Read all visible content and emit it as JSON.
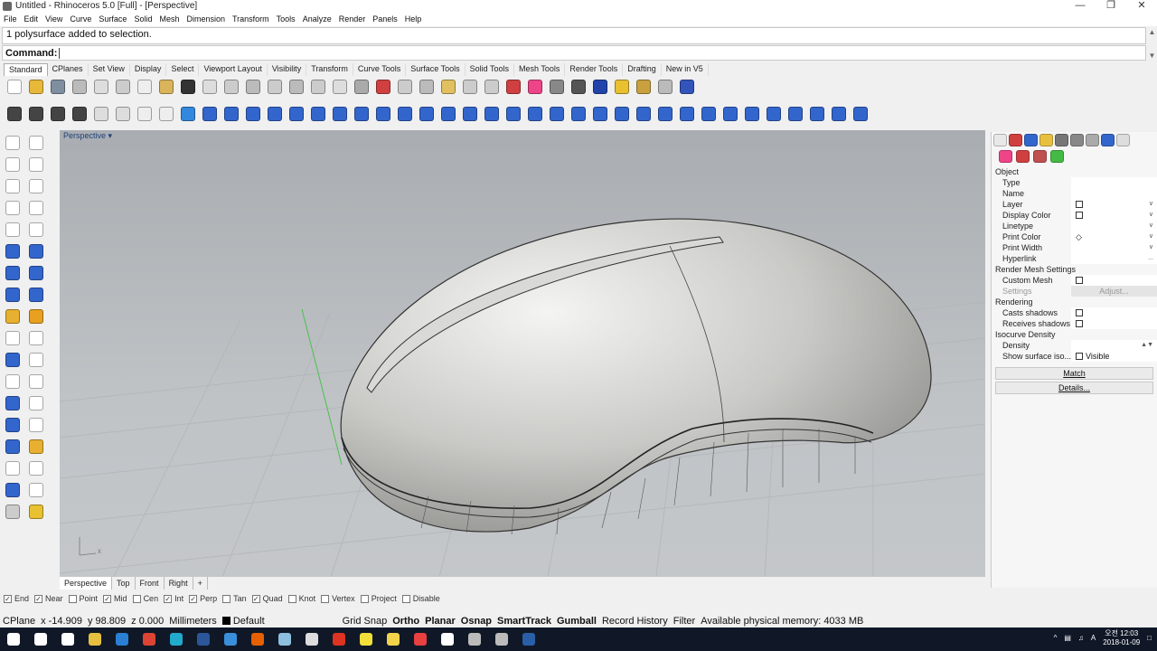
{
  "window": {
    "title": "Untitled - Rhinoceros 5.0 [Full] - [Perspective]",
    "controls": [
      "—",
      "❐",
      "✕"
    ]
  },
  "menu": [
    "File",
    "Edit",
    "View",
    "Curve",
    "Surface",
    "Solid",
    "Mesh",
    "Dimension",
    "Transform",
    "Tools",
    "Analyze",
    "Render",
    "Panels",
    "Help"
  ],
  "command_history": "1 polysurface added to selection.",
  "command": {
    "label": "Command:",
    "value": ""
  },
  "toolbar_tabs": [
    "Standard",
    "CPlanes",
    "Set View",
    "Display",
    "Select",
    "Viewport Layout",
    "Visibility",
    "Transform",
    "Curve Tools",
    "Surface Tools",
    "Solid Tools",
    "Mesh Tools",
    "Render Tools",
    "Drafting",
    "New in V5"
  ],
  "toolbar_icons_row1": [
    {
      "name": "new-icon",
      "color": "#ffffff"
    },
    {
      "name": "open-icon",
      "color": "#e8b83a"
    },
    {
      "name": "save-icon",
      "color": "#7f8f9f"
    },
    {
      "name": "print-icon",
      "color": "#bbbbbb"
    },
    {
      "name": "export-icon",
      "color": "#dddddd"
    },
    {
      "name": "cut-icon",
      "color": "#cccccc"
    },
    {
      "name": "copy-icon",
      "color": "#eeeeee"
    },
    {
      "name": "paste-icon",
      "color": "#d9b45b"
    },
    {
      "name": "undo-icon",
      "color": "#333333"
    },
    {
      "name": "pan-icon",
      "color": "#dddddd"
    },
    {
      "name": "rotate-view-icon",
      "color": "#cccccc"
    },
    {
      "name": "zoom-icon",
      "color": "#bbbbbb"
    },
    {
      "name": "zoom-window-icon",
      "color": "#cccccc"
    },
    {
      "name": "zoom-extents-icon",
      "color": "#bbbbbb"
    },
    {
      "name": "zoom-selected-icon",
      "color": "#cccccc"
    },
    {
      "name": "undo-view-icon",
      "color": "#dddddd"
    },
    {
      "name": "four-views-icon",
      "color": "#aaaaaa"
    },
    {
      "name": "grid-snap-icon",
      "color": "#d04040"
    },
    {
      "name": "cplane-icon",
      "color": "#cccccc"
    },
    {
      "name": "select-icon",
      "color": "#bbbbbb"
    },
    {
      "name": "points-icon",
      "color": "#e0c060"
    },
    {
      "name": "light-icon",
      "color": "#cccccc"
    },
    {
      "name": "lock-icon",
      "color": "#cccccc"
    },
    {
      "name": "layer-icon",
      "color": "#d04040"
    },
    {
      "name": "color-wheel-icon",
      "color": "#ee4488"
    },
    {
      "name": "shaded-icon",
      "color": "#888888"
    },
    {
      "name": "rendered-icon",
      "color": "#555555"
    },
    {
      "name": "render-icon",
      "color": "#2244aa"
    },
    {
      "name": "filter-icon",
      "color": "#e8c030"
    },
    {
      "name": "options-icon",
      "color": "#c8a040"
    },
    {
      "name": "snap-icon",
      "color": "#bbbbbb"
    },
    {
      "name": "help-icon",
      "color": "#3355bb"
    }
  ],
  "toolbar_icons_row2": [
    {
      "name": "mesh-tools-icon",
      "color": "#444444"
    },
    {
      "name": "mesh-tools-2-icon",
      "color": "#444444"
    },
    {
      "name": "mesh-tools-3-icon",
      "color": "#444444"
    },
    {
      "name": "mesh-tools-4-icon",
      "color": "#444444"
    },
    {
      "name": "edge-icon",
      "color": "#dddddd"
    },
    {
      "name": "disk-icon",
      "color": "#dddddd"
    },
    {
      "name": "curve-icon",
      "color": "#eeeeee"
    },
    {
      "name": "arc-icon",
      "color": "#eeeeee"
    },
    {
      "name": "sphere-icon",
      "color": "#3388dd"
    },
    {
      "name": "surface-1-icon",
      "color": "#3366cc"
    },
    {
      "name": "surface-2-icon",
      "color": "#3366cc"
    },
    {
      "name": "surface-3-icon",
      "color": "#3366cc"
    },
    {
      "name": "surface-4-icon",
      "color": "#3366cc"
    },
    {
      "name": "surface-5-icon",
      "color": "#3366cc"
    },
    {
      "name": "surface-6-icon",
      "color": "#3366cc"
    },
    {
      "name": "surface-7-icon",
      "color": "#3366cc"
    },
    {
      "name": "surface-8-icon",
      "color": "#3366cc"
    },
    {
      "name": "surface-9-icon",
      "color": "#3366cc"
    },
    {
      "name": "surface-10-icon",
      "color": "#3366cc"
    },
    {
      "name": "surface-11-icon",
      "color": "#3366cc"
    },
    {
      "name": "surface-12-icon",
      "color": "#3366cc"
    },
    {
      "name": "surface-13-icon",
      "color": "#3366cc"
    },
    {
      "name": "surface-14-icon",
      "color": "#3366cc"
    },
    {
      "name": "surface-15-icon",
      "color": "#3366cc"
    },
    {
      "name": "surface-16-icon",
      "color": "#3366cc"
    },
    {
      "name": "surface-17-icon",
      "color": "#3366cc"
    },
    {
      "name": "surface-18-icon",
      "color": "#3366cc"
    },
    {
      "name": "surface-19-icon",
      "color": "#3366cc"
    },
    {
      "name": "surface-20-icon",
      "color": "#3366cc"
    },
    {
      "name": "surface-21-icon",
      "color": "#3366cc"
    },
    {
      "name": "surface-22-icon",
      "color": "#3366cc"
    },
    {
      "name": "surface-23-icon",
      "color": "#3366cc"
    },
    {
      "name": "surface-24-icon",
      "color": "#3366cc"
    },
    {
      "name": "surface-25-icon",
      "color": "#3366cc"
    },
    {
      "name": "surface-26-icon",
      "color": "#3366cc"
    },
    {
      "name": "surface-27-icon",
      "color": "#3366cc"
    },
    {
      "name": "surface-28-icon",
      "color": "#3366cc"
    },
    {
      "name": "surface-29-icon",
      "color": "#3366cc"
    },
    {
      "name": "surface-30-icon",
      "color": "#3366cc"
    },
    {
      "name": "surface-31-icon",
      "color": "#3366cc"
    }
  ],
  "left_tools": [
    {
      "name": "select-arrow-icon",
      "color": "#ffffff"
    },
    {
      "name": "point-icon",
      "color": "#ffffff"
    },
    {
      "name": "polyline-icon",
      "color": "#ffffff"
    },
    {
      "name": "curve-interp-icon",
      "color": "#ffffff"
    },
    {
      "name": "circle-icon",
      "color": "#ffffff"
    },
    {
      "name": "ellipse-icon",
      "color": "#ffffff"
    },
    {
      "name": "arc-tool-icon",
      "color": "#ffffff"
    },
    {
      "name": "rectangle-icon",
      "color": "#ffffff"
    },
    {
      "name": "polygon-icon",
      "color": "#ffffff"
    },
    {
      "name": "curve-tools-icon",
      "color": "#ffffff"
    },
    {
      "name": "plane-icon",
      "color": "#3366cc"
    },
    {
      "name": "sweep-icon",
      "color": "#3366cc"
    },
    {
      "name": "box-icon",
      "color": "#3366cc"
    },
    {
      "name": "solid-tools-icon",
      "color": "#3366cc"
    },
    {
      "name": "cylinder-icon",
      "color": "#3366cc"
    },
    {
      "name": "mesh-icon",
      "color": "#3366cc"
    },
    {
      "name": "light-bulb-icon",
      "color": "#e8b030"
    },
    {
      "name": "render-tools-icon",
      "color": "#e8a020"
    },
    {
      "name": "transform-icon",
      "color": "#ffffff"
    },
    {
      "name": "analyze-icon",
      "color": "#ffffff"
    },
    {
      "name": "boolean-icon",
      "color": "#3366cc"
    },
    {
      "name": "group-icon",
      "color": "#ffffff"
    },
    {
      "name": "fillet-icon",
      "color": "#ffffff"
    },
    {
      "name": "split-icon",
      "color": "#ffffff"
    },
    {
      "name": "text-icon",
      "color": "#3366cc"
    },
    {
      "name": "dimension-icon",
      "color": "#ffffff"
    },
    {
      "name": "array-icon",
      "color": "#3366cc"
    },
    {
      "name": "block-icon",
      "color": "#ffffff"
    },
    {
      "name": "extrude-icon",
      "color": "#3366cc"
    },
    {
      "name": "ruler-icon",
      "color": "#e8b030"
    },
    {
      "name": "grid-icon",
      "color": "#ffffff"
    },
    {
      "name": "move-icon",
      "color": "#ffffff"
    },
    {
      "name": "properties-icon",
      "color": "#3366cc"
    },
    {
      "name": "check-icon",
      "color": "#ffffff"
    },
    {
      "name": "materials-icon",
      "color": "#cccccc"
    },
    {
      "name": "warning-icon",
      "color": "#e8c030"
    }
  ],
  "viewport": {
    "label": "Perspective",
    "label_arrow": "▾",
    "tabs": [
      "Perspective",
      "Top",
      "Front",
      "Right",
      "+"
    ]
  },
  "osnap": [
    {
      "label": "End",
      "checked": true
    },
    {
      "label": "Near",
      "checked": true
    },
    {
      "label": "Point",
      "checked": false
    },
    {
      "label": "Mid",
      "checked": true
    },
    {
      "label": "Cen",
      "checked": false
    },
    {
      "label": "Int",
      "checked": true
    },
    {
      "label": "Perp",
      "checked": true
    },
    {
      "label": "Tan",
      "checked": false
    },
    {
      "label": "Quad",
      "checked": true
    },
    {
      "label": "Knot",
      "checked": false
    },
    {
      "label": "Vertex",
      "checked": false
    },
    {
      "label": "Project",
      "checked": false
    },
    {
      "label": "Disable",
      "checked": false
    }
  ],
  "status": {
    "cplane": "CPlane",
    "x": "x -14.909",
    "y": "y 98.809",
    "z": "z 0.000",
    "units": "Millimeters",
    "layer": "Default",
    "grid_snap": "Grid Snap",
    "ortho": "Ortho",
    "planar": "Planar",
    "osnap": "Osnap",
    "smarttrack": "SmartTrack",
    "gumball": "Gumball",
    "record_history": "Record History",
    "filter": "Filter",
    "memory": "Available physical memory: 4033 MB"
  },
  "panel": {
    "object_header": "Object",
    "rows": [
      {
        "label": "Type",
        "value": ""
      },
      {
        "label": "Name",
        "value": ""
      },
      {
        "label": "Layer",
        "value": "",
        "checkbox": true,
        "dropdown": true
      },
      {
        "label": "Display Color",
        "value": "",
        "checkbox": true,
        "dropdown": true
      },
      {
        "label": "Linetype",
        "value": "",
        "dropdown": true
      },
      {
        "label": "Print Color",
        "value": "◇",
        "dropdown": true
      },
      {
        "label": "Print Width",
        "value": "",
        "dropdown": true
      },
      {
        "label": "Hyperlink",
        "value": "",
        "more": "..."
      }
    ],
    "render_mesh_header": "Render Mesh Settings",
    "custom_mesh": "Custom Mesh",
    "settings": "Settings",
    "adjust": "Adjust...",
    "rendering_header": "Rendering",
    "casts_shadows": "Casts shadows",
    "receives_shadows": "Receives shadows",
    "isocurve_header": "Isocurve Density",
    "density": "Density",
    "show_surface": "Show surface iso...",
    "visible": "Visible",
    "match": "Match",
    "details": "Details..."
  },
  "taskbar": {
    "apps": [
      {
        "name": "start-icon",
        "color": "#ffffff"
      },
      {
        "name": "search-icon",
        "color": "#ffffff"
      },
      {
        "name": "task-view-icon",
        "color": "#ffffff"
      },
      {
        "name": "file-explorer-icon",
        "color": "#e8c040"
      },
      {
        "name": "edge-browser-icon",
        "color": "#2a7fd4"
      },
      {
        "name": "chrome-icon",
        "color": "#dd4433"
      },
      {
        "name": "bird-app-icon",
        "color": "#22aacc"
      },
      {
        "name": "word-icon",
        "color": "#2b579a"
      },
      {
        "name": "mail-icon",
        "color": "#3a8fdb"
      },
      {
        "name": "firefox-icon",
        "color": "#e66000"
      },
      {
        "name": "app-icon",
        "color": "#8fbfdf"
      },
      {
        "name": "calculator-icon",
        "color": "#dddddd"
      },
      {
        "name": "pdf-icon",
        "color": "#dd3322"
      },
      {
        "name": "talk-icon",
        "color": "#f2e03a"
      },
      {
        "name": "notes-icon",
        "color": "#f2d44a"
      },
      {
        "name": "record-icon",
        "color": "#e84040"
      },
      {
        "name": "presentation-icon",
        "color": "#ffffff"
      },
      {
        "name": "rhino-icon",
        "color": "#bbbbbb"
      },
      {
        "name": "rhino-2-icon",
        "color": "#bbbbbb"
      },
      {
        "name": "rhino-3-icon",
        "color": "#2a5fa8"
      }
    ],
    "ime": "A",
    "time": "오전 12:03",
    "date": "2018-01-09"
  }
}
